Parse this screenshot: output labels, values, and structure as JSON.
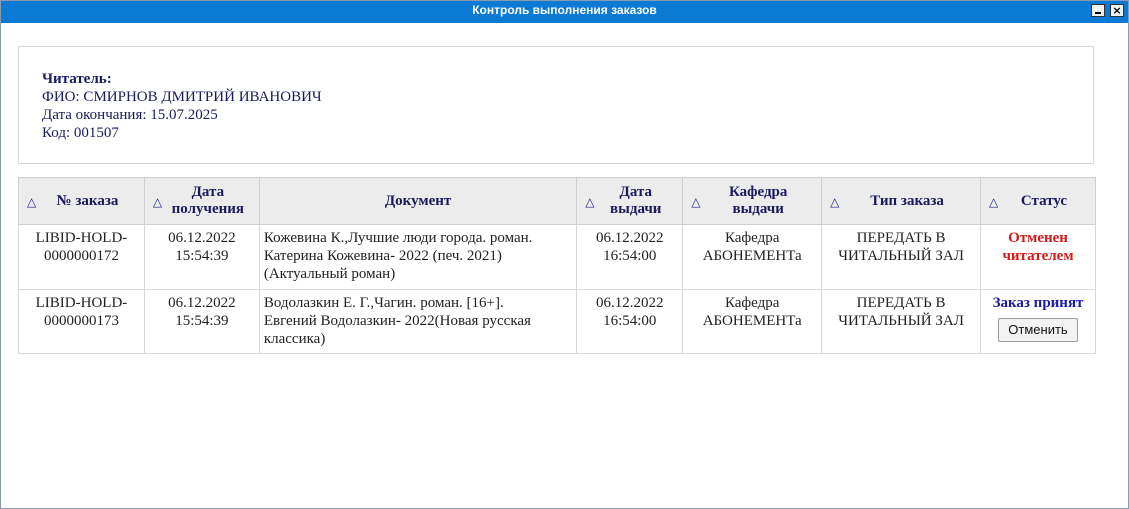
{
  "window": {
    "title": "Контроль выполнения заказов",
    "minimize_icon": "minimize-icon",
    "close_glyph": "×"
  },
  "reader": {
    "label": "Читатель:",
    "fio": "ФИО: СМИРНОВ ДМИТРИЙ ИВАНОВИЧ",
    "end_date": "Дата окончания: 15.07.2025",
    "code": "Код: 001507"
  },
  "table": {
    "sort_glyph": "△",
    "headers": {
      "order_no": "№ заказа",
      "received_l1": "Дата",
      "received_l2": "получения",
      "document": "Документ",
      "issued_l1": "Дата",
      "issued_l2": "выдачи",
      "dept_l1": "Кафедра",
      "dept_l2": "выдачи",
      "type": "Тип заказа",
      "status": "Статус"
    },
    "rows": [
      {
        "order_l1": "LIBID-HOLD-",
        "order_l2": "0000000172",
        "received_date": "06.12.2022",
        "received_time": "15:54:39",
        "doc_l1": "Кожевина К.,Лучшие люди города. роман.",
        "doc_l2": "Катерина Кожевина- 2022 (печ. 2021)",
        "doc_l3": "(Актуальный роман)",
        "issued_date": "06.12.2022",
        "issued_time": "16:54:00",
        "dept_l1": "Кафедра",
        "dept_l2": "АБОНЕМЕНТа",
        "type_l1": "ПЕРЕДАТЬ В",
        "type_l2": "ЧИТАЛЬНЫЙ ЗАЛ",
        "status_l1": "Отменен",
        "status_l2": "читателем"
      },
      {
        "order_l1": "LIBID-HOLD-",
        "order_l2": "0000000173",
        "received_date": "06.12.2022",
        "received_time": "15:54:39",
        "doc_l1": "Водолазкин Е. Г.,Чагин. роман. [16+].",
        "doc_l2": "Евгений Водолазкин- 2022(Новая русская",
        "doc_l3": "классика)",
        "issued_date": "06.12.2022",
        "issued_time": "16:54:00",
        "dept_l1": "Кафедра",
        "dept_l2": "АБОНЕМЕНТа",
        "type_l1": "ПЕРЕДАТЬ В",
        "type_l2": "ЧИТАЛЬНЫЙ ЗАЛ",
        "status": "Заказ принят",
        "cancel_button": "Отменить"
      }
    ]
  },
  "colors": {
    "titlebar": "#0a7ad4",
    "header_text": "#1a1a5e",
    "status_cancelled": "#d41a1a",
    "status_accepted": "#1a1aa8"
  }
}
